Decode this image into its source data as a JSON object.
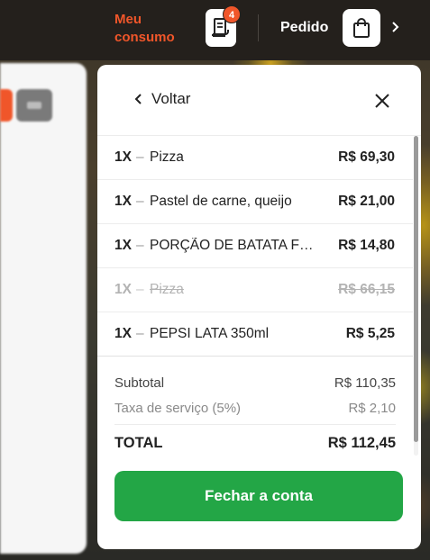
{
  "header": {
    "meu_consumo_line1": "Meu",
    "meu_consumo_line2": "consumo",
    "consumption_badge": "4",
    "pedido_label": "Pedido"
  },
  "modal": {
    "back_label": "Voltar",
    "items": [
      {
        "qty": "1X",
        "sep": "–",
        "name": "Pizza",
        "price": "R$ 69,30",
        "cancelled": false
      },
      {
        "qty": "1X",
        "sep": "–",
        "name": "Pastel de carne, queijo",
        "price": "R$ 21,00",
        "cancelled": false
      },
      {
        "qty": "1X",
        "sep": "–",
        "name": "PORÇÃO DE BATATA FRITA",
        "price": "R$ 14,80",
        "cancelled": false
      },
      {
        "qty": "1X",
        "sep": "–",
        "name": "Pizza",
        "price": "R$ 66,15",
        "cancelled": true
      },
      {
        "qty": "1X",
        "sep": "–",
        "name": "PEPSI LATA 350ml",
        "price": "R$ 5,25",
        "cancelled": false
      }
    ],
    "summary": {
      "subtotal_label": "Subtotal",
      "subtotal_value": "R$ 110,35",
      "tax_label": "Taxa de serviço (5%)",
      "tax_value": "R$ 2,10",
      "total_label": "TOTAL",
      "total_value": "R$ 112,45"
    },
    "close_bill_label": "Fechar a conta"
  },
  "colors": {
    "accent_orange": "#f0562a",
    "action_green": "#23a646"
  }
}
